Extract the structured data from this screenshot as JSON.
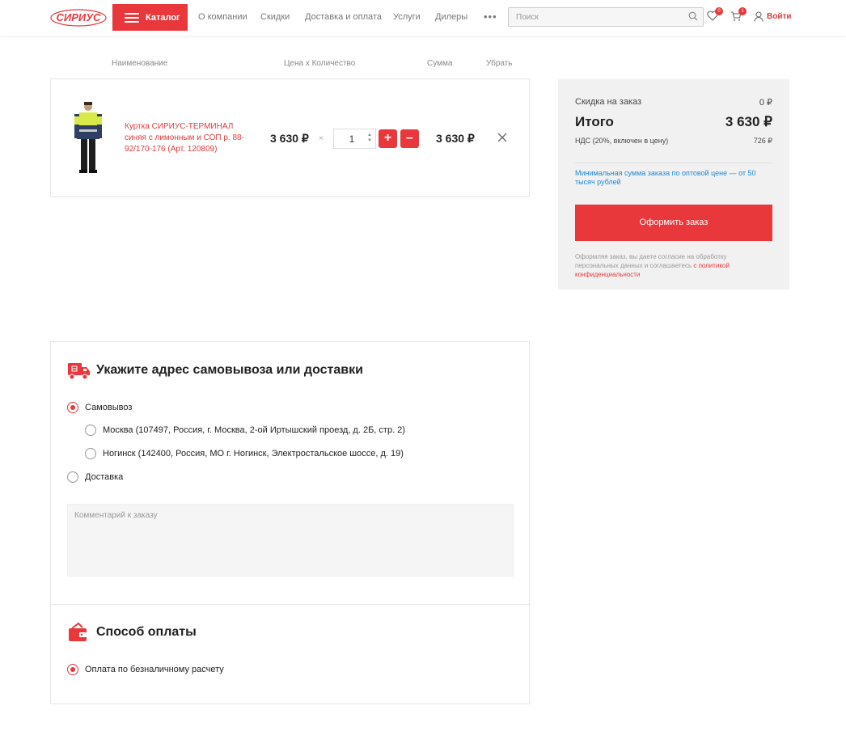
{
  "header": {
    "logo_text": "СИРИУС",
    "catalog_label": "Каталог",
    "nav": [
      "О компании",
      "Скидки",
      "Доставка и оплата",
      "Услуги",
      "Дилеры"
    ],
    "more_label": "•••",
    "search_placeholder": "Поиск",
    "favorites_count": "0",
    "cart_count": "1",
    "login_label": "Войти"
  },
  "table_headers": {
    "name": "Наименование",
    "price_qty": "Цена х Количество",
    "sum": "Сумма",
    "remove": "Убрать"
  },
  "cart_item": {
    "name": "Куртка СИРИУС-ТЕРМИНАЛ синяя с лимонным и СОП р. 88-92/170-176 (Арт. 120809)",
    "price": "3 630 ₽",
    "times": "×",
    "quantity": "1",
    "plus": "+",
    "minus": "–",
    "sum": "3 630 ₽"
  },
  "summary": {
    "discount_label": "Скидка на заказ",
    "discount_value": "0 ₽",
    "total_label": "Итого",
    "total_value": "3 630 ₽",
    "vat_label": "НДС (20%, включен в цену)",
    "vat_value": "726 ₽",
    "min_notice": "Минимальная сумма заказа по оптовой цене — от 50 тысяч рублей",
    "order_button": "Оформить заказ",
    "consent_text": "Оформляя заказ, вы даете согласие на обработку персональных данных и соглашаетесь ",
    "consent_link": "с политикой конфиденциальности"
  },
  "delivery": {
    "title": "Укажите адрес самовывоза или доставки",
    "pickup_label": "Самовывоз",
    "pickup_options": [
      "Москва (107497, Россия, г. Москва, 2-ой Иртышский проезд, д. 2Б, стр. 2)",
      "Ногинск (142400, Россия, МО г. Ногинск, Электростальское шоссе, д. 19)"
    ],
    "delivery_label": "Доставка",
    "comment_placeholder": "Комментарий к заказу"
  },
  "payment": {
    "title": "Способ оплаты",
    "option": "Оплата по безналичному расчету"
  },
  "colors": {
    "accent": "#e8383b",
    "link_blue": "#1b8ad6"
  }
}
